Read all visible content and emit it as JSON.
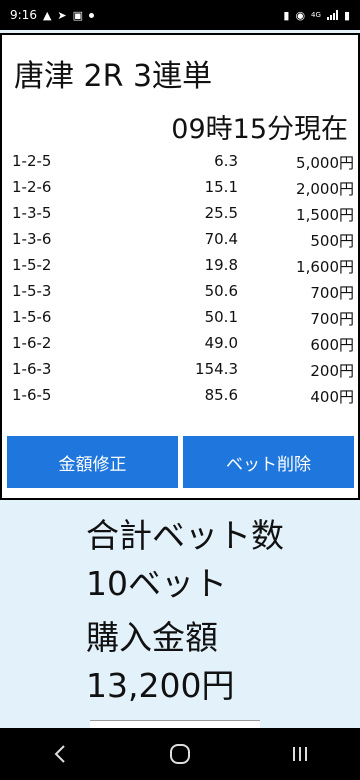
{
  "status_bar": {
    "time": "9:16",
    "left_icons": [
      "warning-icon",
      "navigation-icon",
      "image-icon"
    ],
    "right_icons": [
      "battery-saver-icon",
      "location-icon",
      "network-4g-icon",
      "signal-icon",
      "battery-icon"
    ],
    "network_label": "4G"
  },
  "card": {
    "title": "唐津 2R 3連単",
    "time": "09時15分現在",
    "bets": [
      {
        "combo": "1-2-5",
        "odds": "6.3",
        "amount": "5,000円"
      },
      {
        "combo": "1-2-6",
        "odds": "15.1",
        "amount": "2,000円"
      },
      {
        "combo": "1-3-5",
        "odds": "25.5",
        "amount": "1,500円"
      },
      {
        "combo": "1-3-6",
        "odds": "70.4",
        "amount": "500円"
      },
      {
        "combo": "1-5-2",
        "odds": "19.8",
        "amount": "1,600円"
      },
      {
        "combo": "1-5-3",
        "odds": "50.6",
        "amount": "700円"
      },
      {
        "combo": "1-5-6",
        "odds": "50.1",
        "amount": "700円"
      },
      {
        "combo": "1-6-2",
        "odds": "49.0",
        "amount": "600円"
      },
      {
        "combo": "1-6-3",
        "odds": "154.3",
        "amount": "200円"
      },
      {
        "combo": "1-6-5",
        "odds": "85.6",
        "amount": "400円"
      }
    ],
    "edit_button": "金額修正",
    "delete_button": "ベット削除"
  },
  "summary": {
    "total_bets_label": "合計ベット数",
    "total_bets_value": "10ベット",
    "purchase_label": "購入金額",
    "purchase_value": "13,200円"
  },
  "colors": {
    "accent": "#1f77dd",
    "background": "#e3f1fb"
  },
  "nav_bar": {
    "icons": [
      "back-icon",
      "home-icon",
      "recents-icon"
    ]
  }
}
